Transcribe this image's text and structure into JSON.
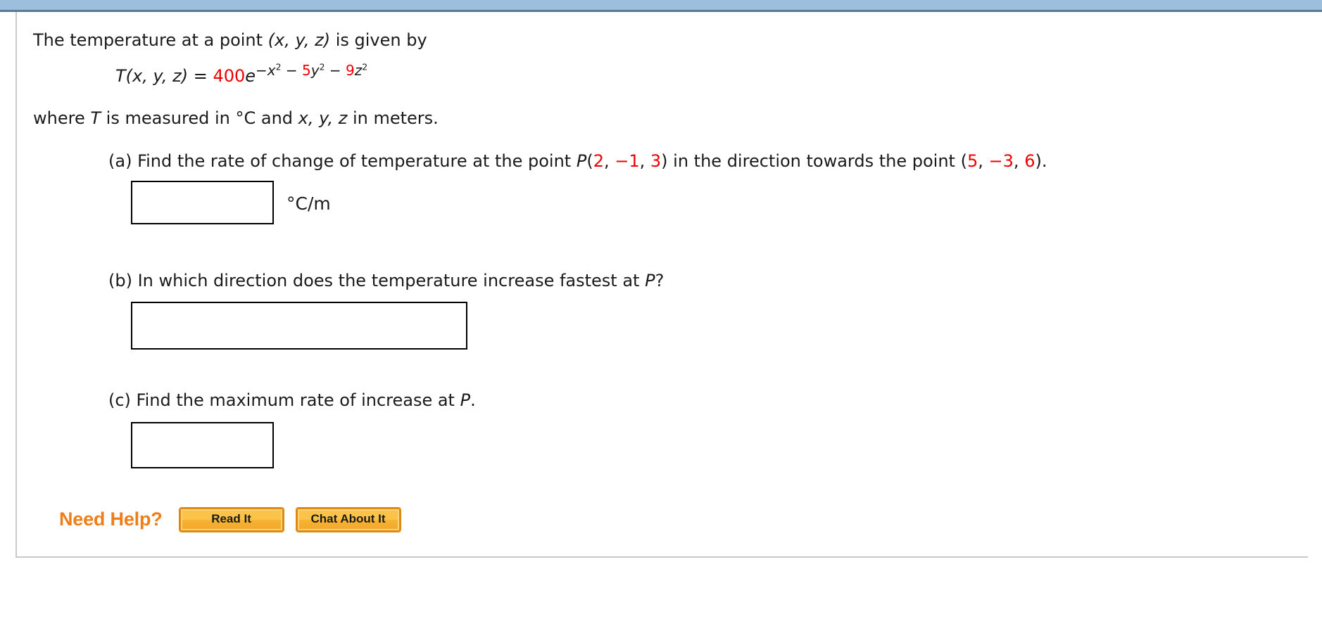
{
  "window": {
    "top_bar_color": "#9bbfdc",
    "top_bar_accent_color": "#5e7792",
    "panel_border_color": "#c9c9c9"
  },
  "problem": {
    "intro_prefix": "The temperature at a point ",
    "intro_point": "(x, y, z)",
    "intro_suffix": " is given by",
    "formula": {
      "function_name": "T",
      "arguments": "(x, y, z)",
      "equals": "=",
      "coefficient": "400",
      "base": "e",
      "exponent_plain": "−x² − 5y² − 9z²",
      "exponent_parts": [
        {
          "text": "−x",
          "color": "#1a1a1a",
          "sup": "2"
        },
        {
          "text": " − ",
          "color": "#1a1a1a",
          "sup": ""
        },
        {
          "text": "5",
          "color": "#ee0000",
          "sup": ""
        },
        {
          "text": "y",
          "color": "#1a1a1a",
          "sup": "2"
        },
        {
          "text": " − ",
          "color": "#1a1a1a",
          "sup": ""
        },
        {
          "text": "9",
          "color": "#ee0000",
          "sup": ""
        },
        {
          "text": "z",
          "color": "#1a1a1a",
          "sup": "2"
        }
      ],
      "full_text": "T(x, y, z) = 400e−x² − 5y² − 9z²"
    },
    "where_prefix": "where ",
    "where_T": "T",
    "where_mid": " is measured in °C and ",
    "where_vars": "x, y, z",
    "where_suffix": " in meters.",
    "accent_color": "#ee0000"
  },
  "parts": {
    "a": {
      "label": "(a)",
      "text_before_point": " Find the rate of change of temperature at the point ",
      "point_name": "P",
      "point_open": "(",
      "point_values": [
        "2",
        "−1",
        "3"
      ],
      "point_close": ")",
      "text_middle": " in the direction towards the point ",
      "target_open": "(",
      "target_values": [
        "5",
        "−3",
        "6"
      ],
      "target_close": ").",
      "full_text": "(a) Find the rate of change of temperature at the point P(2, −1, 3) in the direction towards the point (5, −3, 6).",
      "answer_value": "",
      "answer_placeholder": "",
      "unit": "°C/m"
    },
    "b": {
      "label": "(b)",
      "text": " In which direction does the temperature increase fastest at ",
      "point_name": "P",
      "text_end": "?",
      "full_text": "(b) In which direction does the temperature increase fastest at P?",
      "answer_value": "",
      "answer_placeholder": ""
    },
    "c": {
      "label": "(c)",
      "text": " Find the maximum rate of increase at ",
      "point_name": "P",
      "text_end": ".",
      "full_text": "(c) Find the maximum rate of increase at P.",
      "answer_value": "",
      "answer_placeholder": ""
    }
  },
  "help": {
    "label": "Need Help?",
    "label_color": "#f07d18",
    "buttons": [
      {
        "label": "Read It"
      },
      {
        "label": "Chat About It"
      }
    ]
  }
}
